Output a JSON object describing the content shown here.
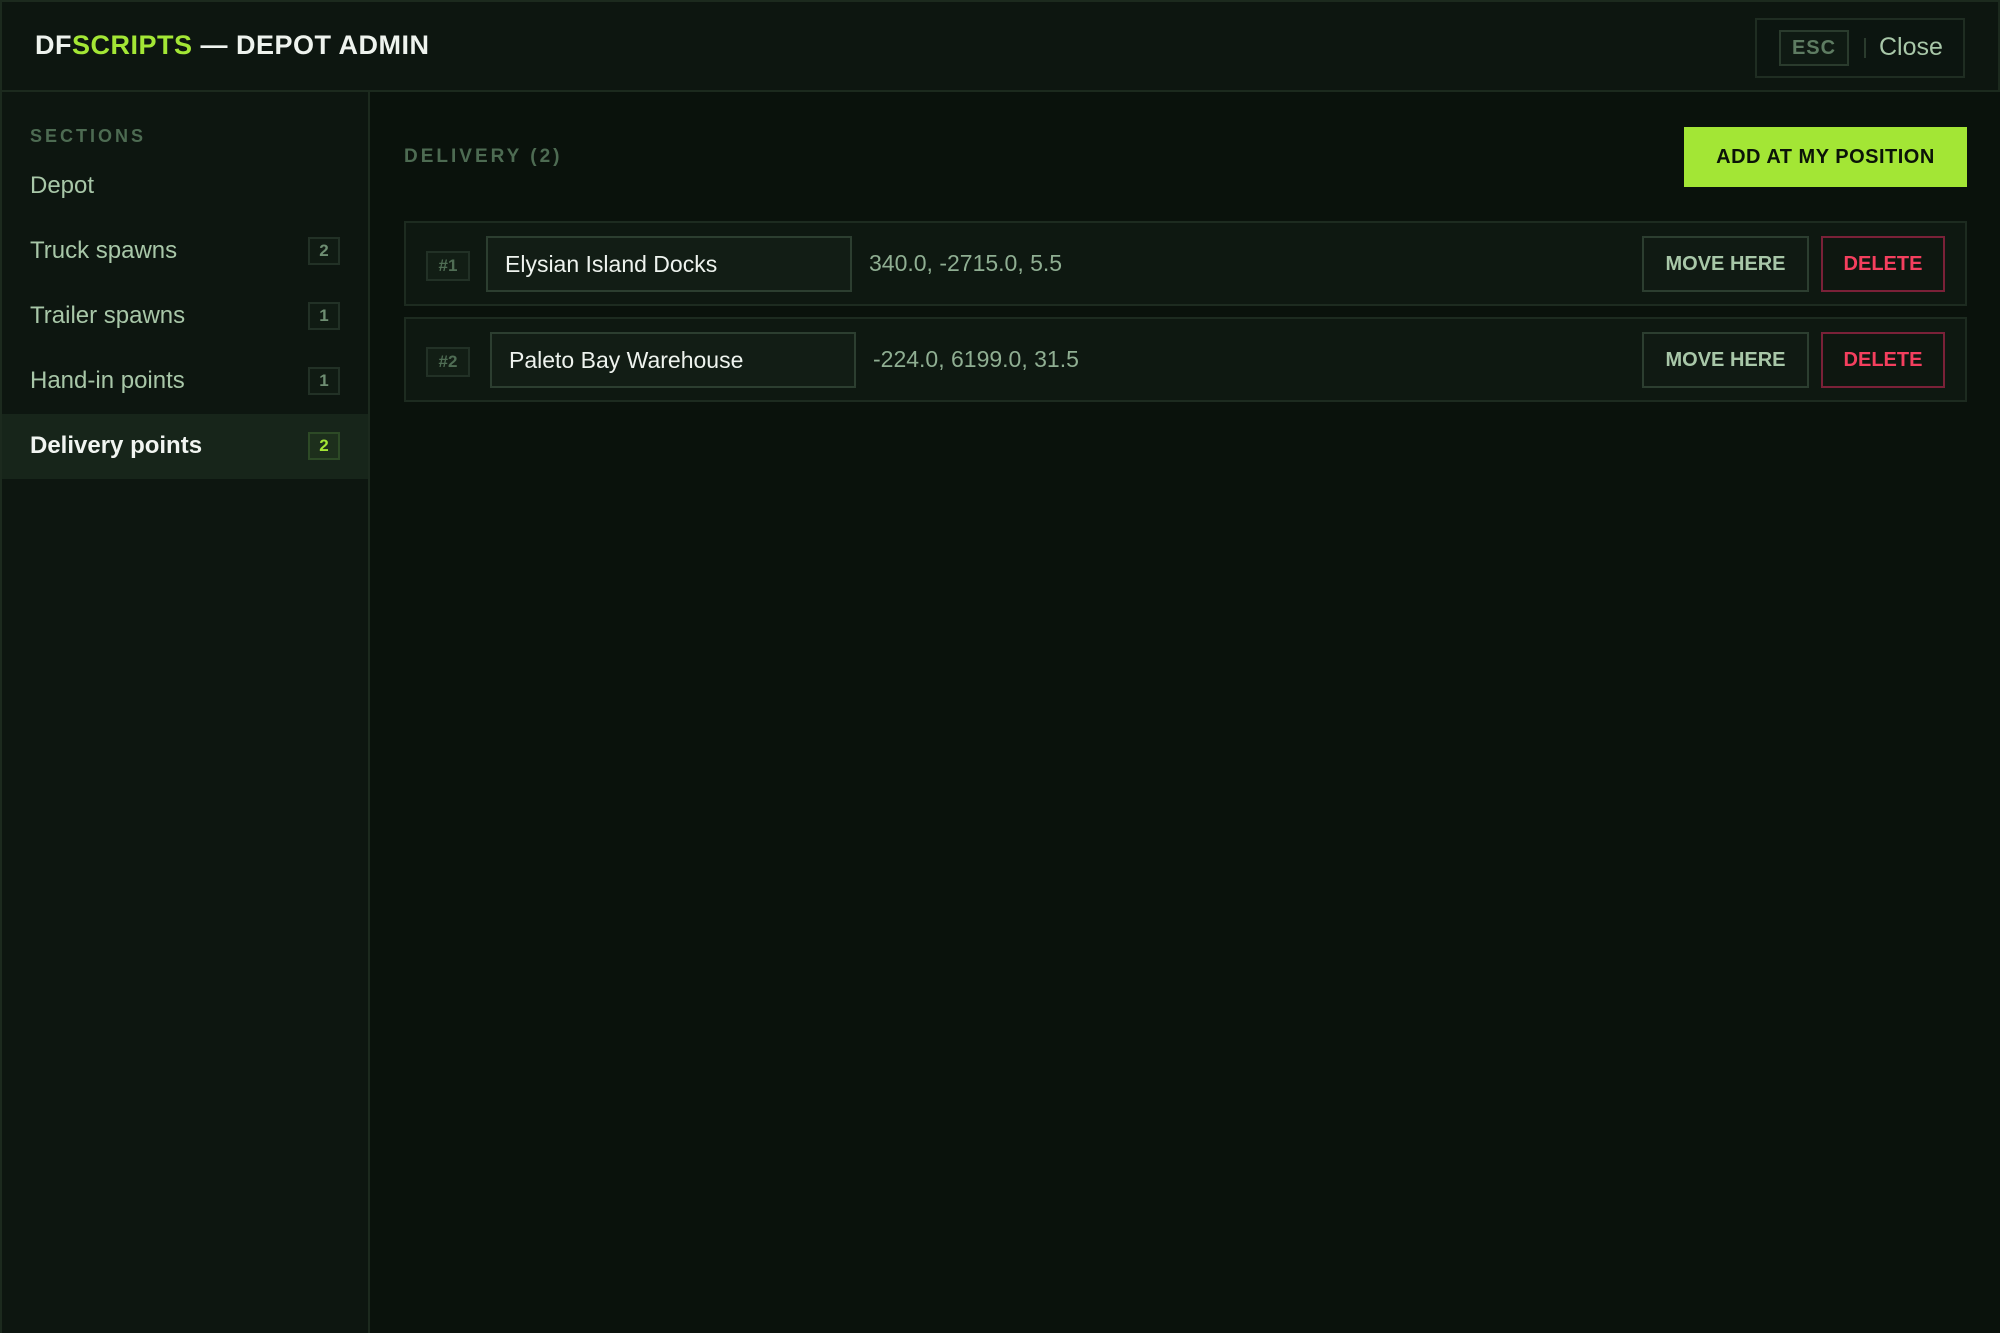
{
  "app": {
    "brand_prefix": "DF",
    "brand_accent": "SCRIPTS",
    "brand_suffix": " — DEPOT ADMIN",
    "esc_label": "ESC",
    "close_label": "Close",
    "accent_color": "#a3e635",
    "danger_color": "#f43f5e"
  },
  "sidebar": {
    "heading": "SECTIONS",
    "items": [
      {
        "label": "Depot",
        "count": ""
      },
      {
        "label": "Truck spawns",
        "count": "2"
      },
      {
        "label": "Trailer spawns",
        "count": "1"
      },
      {
        "label": "Hand-in points",
        "count": "1"
      },
      {
        "label": "Delivery points",
        "count": "2",
        "active": true
      }
    ]
  },
  "main": {
    "section_title": "DELIVERY (2)",
    "add_button": "ADD AT MY POSITION",
    "rows": [
      {
        "index": "#1",
        "name": "Elysian Island Docks",
        "coords": "340.0, -2715.0, 5.5",
        "move_label": "MOVE HERE",
        "delete_label": "DELETE"
      },
      {
        "index": "#2",
        "name": "Paleto Bay Warehouse",
        "coords": "-224.0, 6199.0, 31.5",
        "move_label": "MOVE HERE",
        "delete_label": "DELETE"
      }
    ]
  }
}
